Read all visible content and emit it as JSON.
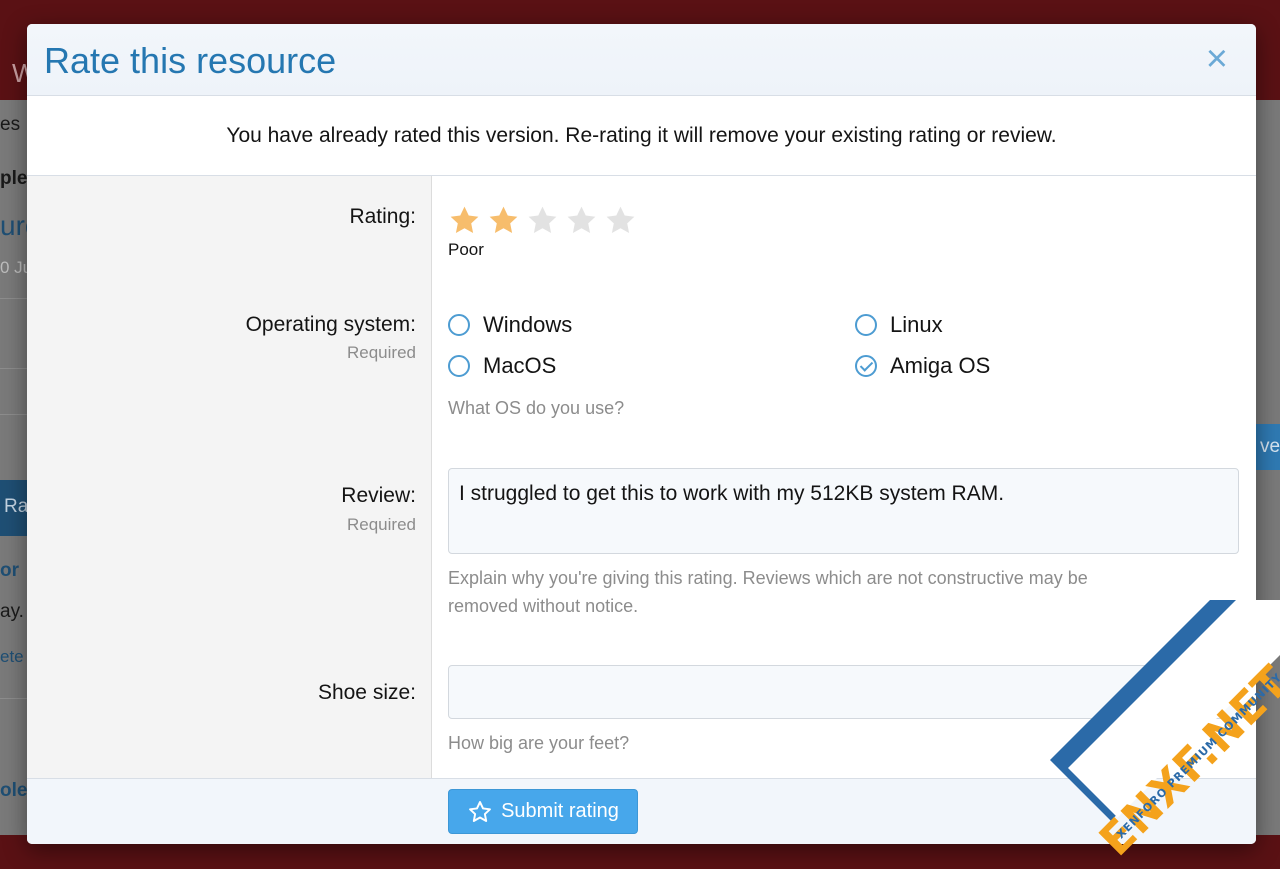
{
  "background": {
    "header_letter": "W",
    "fragments": [
      "es",
      "ple",
      "urc",
      "0 Ju",
      "Ra",
      "or",
      "ay.",
      "ete",
      "ole",
      "ve"
    ]
  },
  "modal": {
    "title": "Rate this resource",
    "close_label": "×",
    "notice": "You have already rated this version. Re-rating it will remove your existing rating or review."
  },
  "rating": {
    "label": "Rating:",
    "value": 2,
    "max": 5,
    "value_text": "Poor",
    "filled_color": "#f7bd6c",
    "empty_color": "#e2e2e2"
  },
  "os": {
    "label": "Operating system:",
    "required": "Required",
    "options": [
      {
        "label": "Windows",
        "checked": false
      },
      {
        "label": "Linux",
        "checked": false
      },
      {
        "label": "MacOS",
        "checked": false
      },
      {
        "label": "Amiga OS",
        "checked": true
      }
    ],
    "explain": "What OS do you use?"
  },
  "review": {
    "label": "Review:",
    "required": "Required",
    "value": "I struggled to get this to work with my 512KB system RAM.",
    "explain_1": "Explain why you're giving this rating. Reviews which are not constructive may be",
    "explain_2": "removed without notice."
  },
  "shoe": {
    "label": "Shoe size:",
    "value": "",
    "explain": "How big are your feet?"
  },
  "footer": {
    "submit_label": "Submit rating"
  },
  "watermark": {
    "text": "ENXF.NET",
    "sub": "XENFORO PREMIUM COMMUNITY"
  },
  "colors": {
    "accent": "#2577b1",
    "button": "#47a7eb",
    "header_bg": "#5a1114"
  }
}
